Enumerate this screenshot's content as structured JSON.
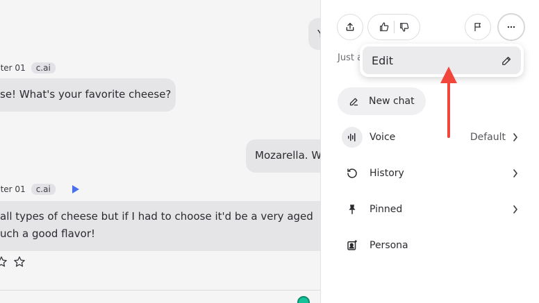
{
  "chat": {
    "top_bubble_text": "Y",
    "msg1": {
      "author": "cter 01",
      "badge": "c.ai",
      "text": "se! What's your favorite cheese?"
    },
    "user_msg": {
      "text": "Mozarella. W"
    },
    "msg2": {
      "author": "cter 01",
      "badge": "c.ai",
      "line1": "all types of cheese but if I had to choose it'd be a very aged",
      "line2": "uch a good flavor!"
    }
  },
  "panel": {
    "just_text": "Just a",
    "dropdown": {
      "edit_label": "Edit"
    },
    "new_chat_label": "New chat",
    "menu": [
      {
        "label": "Voice",
        "value": "Default",
        "icon": "voice-icon"
      },
      {
        "label": "History",
        "icon": "history-icon"
      },
      {
        "label": "Pinned",
        "icon": "pin-icon"
      },
      {
        "label": "Persona",
        "icon": "persona-icon"
      }
    ]
  },
  "colors": {
    "accent_arrow": "#f0463c",
    "play": "#4a6ef0",
    "bubble": "#e5e5e8"
  }
}
